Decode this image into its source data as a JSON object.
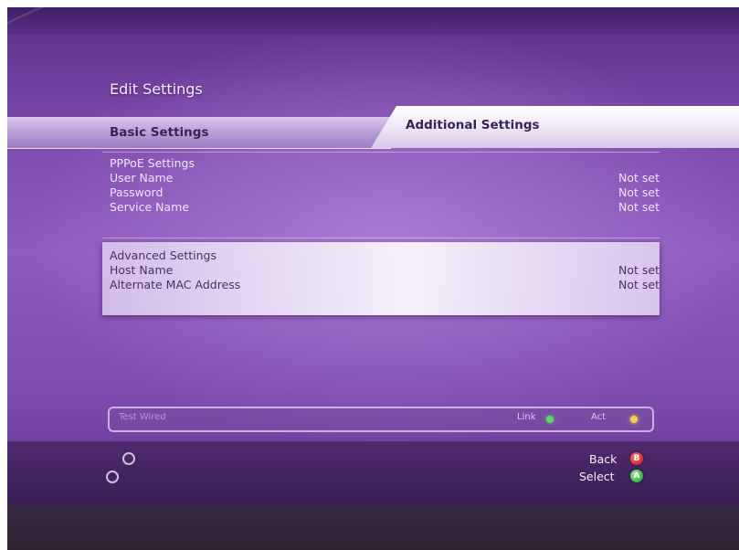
{
  "title": "Edit Settings",
  "tabs": [
    {
      "label": "Basic Settings",
      "selected": false
    },
    {
      "label": "Additional Settings",
      "selected": true
    }
  ],
  "pppoe": {
    "heading": "PPPoE Settings",
    "rows": [
      {
        "label": "User Name",
        "value": "Not set"
      },
      {
        "label": "Password",
        "value": "Not set"
      },
      {
        "label": "Service Name",
        "value": "Not set"
      }
    ]
  },
  "advanced": {
    "heading": "Advanced Settings",
    "rows": [
      {
        "label": "Host Name",
        "value": "Not set"
      },
      {
        "label": "Alternate MAC Address",
        "value": "Not set"
      }
    ]
  },
  "status_bar": {
    "message": "Test Wired",
    "link_label": "Link",
    "act_label": "Act",
    "link_color": "#5fd25f",
    "act_color": "#f2d24a"
  },
  "buttons": {
    "back_label": "Back",
    "select_label": "Select",
    "back_icon": "b-button-icon",
    "select_icon": "a-button-icon",
    "back_color": "#d42020",
    "select_color": "#2aa83a"
  },
  "colors": {
    "background": "#7b49aa",
    "highlight": "#f4eefa"
  }
}
